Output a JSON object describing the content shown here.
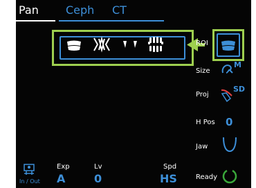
{
  "tabs": [
    "Pan",
    "Ceph",
    "CT"
  ],
  "panel": {
    "roi_label": "ROI",
    "size_label": "Size",
    "size_value": "M",
    "proj_label": "Proj",
    "proj_value": "SD",
    "hpos_label": "H Pos",
    "hpos_value": "0",
    "jaw_label": "Jaw",
    "ready_label": "Ready"
  },
  "bottom": {
    "inout_label": "In / Out",
    "exp_label": "Exp",
    "exp_value": "A",
    "lv_label": "Lv",
    "lv_value": "0",
    "spd_label": "Spd",
    "spd_value": "HS"
  },
  "icons": {
    "roi_options": [
      "full-arch-icon",
      "anterior-teeth-icon",
      "molar-teeth-icon",
      "bitewing-icon"
    ],
    "roi_selected": "full-arch-icon",
    "size": "head-size-icon",
    "proj": "projection-icon",
    "jaw": "jaw-shape-icon",
    "ready": "ready-indicator-icon",
    "inout": "patient-in-out-icon"
  },
  "colors": {
    "accent": "#3d8fd8",
    "highlight": "#9ecf4f",
    "background": "#050505",
    "text": "#ffffff",
    "ready_ring": "#3aa83a",
    "proj_mark": "#e04040"
  }
}
